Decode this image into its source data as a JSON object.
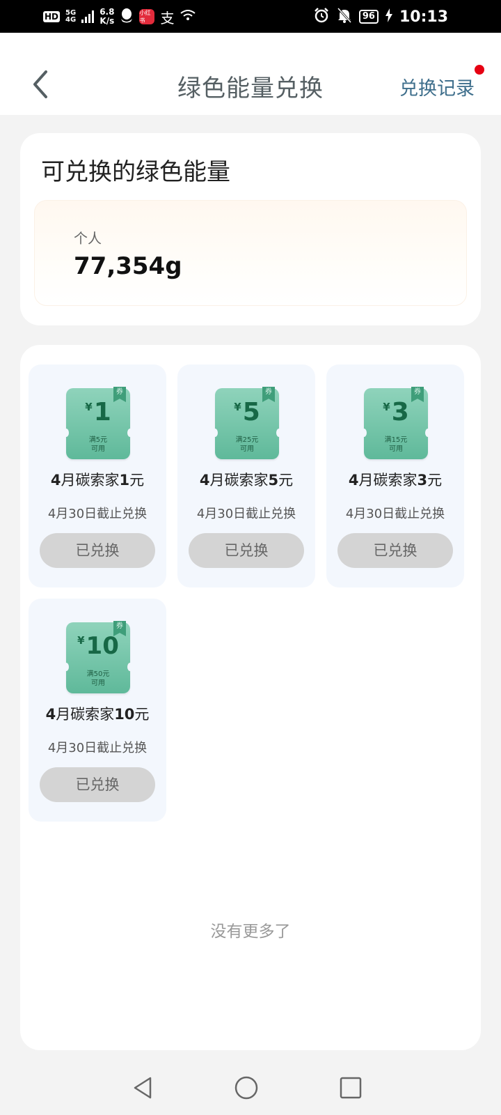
{
  "status_bar": {
    "hd_badge": "HD",
    "network": "5G",
    "network_sub": "4G",
    "speed_value": "6.8",
    "speed_unit": "K/s",
    "red_app": "小红书",
    "alipay_glyph": "支",
    "battery": "96",
    "time": "10:13"
  },
  "header": {
    "title": "绿色能量兑换",
    "history_link": "兑换记录"
  },
  "energy": {
    "title": "可兑换的绿色能量",
    "label": "个人",
    "value": "77,354g"
  },
  "coupons": [
    {
      "amount": "1",
      "yen": "¥",
      "tag": "券",
      "note_line1": "满5元",
      "note_line2": "可用",
      "name_month": "4",
      "name_mid": "月碳索家",
      "name_num": "1",
      "name_unit": "元",
      "deadline": "4月30日截止兑换",
      "button": "已兑换"
    },
    {
      "amount": "5",
      "yen": "¥",
      "tag": "券",
      "note_line1": "满25元",
      "note_line2": "可用",
      "name_month": "4",
      "name_mid": "月碳索家",
      "name_num": "5",
      "name_unit": "元",
      "deadline": "4月30日截止兑换",
      "button": "已兑换"
    },
    {
      "amount": "3",
      "yen": "¥",
      "tag": "券",
      "note_line1": "满15元",
      "note_line2": "可用",
      "name_month": "4",
      "name_mid": "月碳索家",
      "name_num": "3",
      "name_unit": "元",
      "deadline": "4月30日截止兑换",
      "button": "已兑换"
    },
    {
      "amount": "10",
      "yen": "¥",
      "tag": "券",
      "note_line1": "满50元",
      "note_line2": "可用",
      "name_month": "4",
      "name_mid": "月碳索家",
      "name_num": "10",
      "name_unit": "元",
      "deadline": "4月30日截止兑换",
      "button": "已兑换"
    }
  ],
  "footer_text": "没有更多了",
  "icons": {
    "back": "chevron-left-icon",
    "nav_back": "triangle-back-icon",
    "nav_home": "circle-home-icon",
    "nav_recent": "square-recent-icon"
  },
  "colors": {
    "accent_green": "#5fb99a",
    "link_blue": "#3f6f8c",
    "red_dot": "#e60012"
  }
}
